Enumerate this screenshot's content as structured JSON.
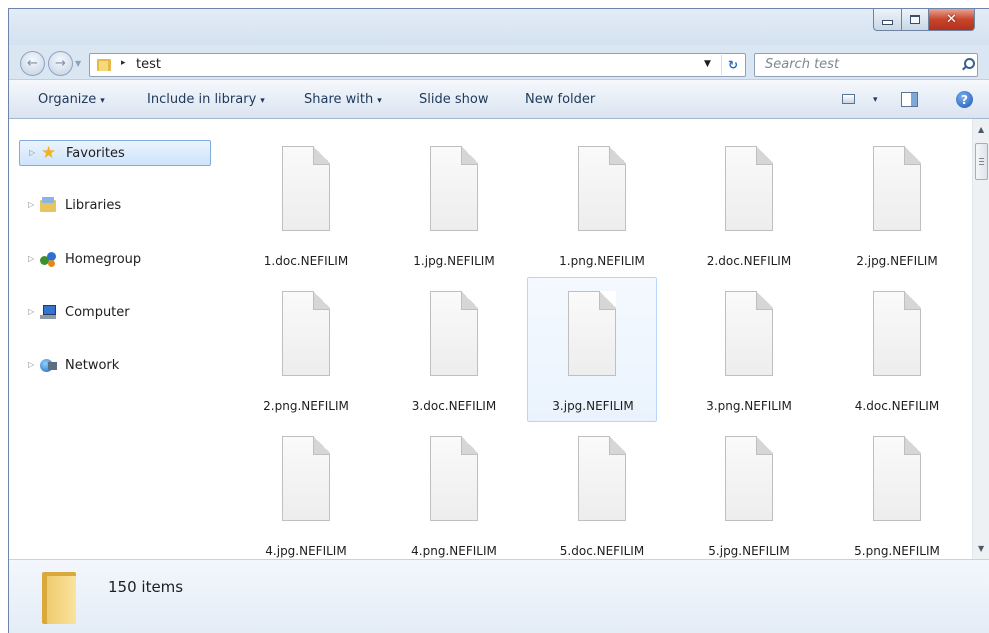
{
  "window": {
    "minimize_icon": "minimize-icon",
    "maximize_icon": "maximize-icon",
    "close_icon": "close-icon",
    "close_color": "#c8452c"
  },
  "nav": {
    "back_icon": "back-arrow-icon",
    "forward_icon": "forward-arrow-icon"
  },
  "address": {
    "separator": "▸",
    "path": "test",
    "dropdown": "▼",
    "refresh": "↻"
  },
  "search": {
    "placeholder": "Search test"
  },
  "toolbar": {
    "organize": "Organize",
    "include_in_library": "Include in library",
    "share_with": "Share with",
    "slide_show": "Slide show",
    "new_folder": "New folder",
    "caret": "▾",
    "help": "?"
  },
  "sidebar": {
    "items": [
      {
        "label": "Favorites",
        "icon": "star-icon"
      },
      {
        "label": "Libraries",
        "icon": "libraries-icon"
      },
      {
        "label": "Homegroup",
        "icon": "homegroup-icon"
      },
      {
        "label": "Computer",
        "icon": "computer-icon"
      },
      {
        "label": "Network",
        "icon": "network-icon"
      }
    ]
  },
  "files": [
    "1.doc.NEFILIM",
    "1.jpg.NEFILIM",
    "1.png.NEFILIM",
    "2.doc.NEFILIM",
    "2.jpg.NEFILIM",
    "2.png.NEFILIM",
    "3.doc.NEFILIM",
    "3.jpg.NEFILIM",
    "3.png.NEFILIM",
    "4.doc.NEFILIM",
    "4.jpg.NEFILIM",
    "4.png.NEFILIM",
    "5.doc.NEFILIM",
    "5.jpg.NEFILIM",
    "5.png.NEFILIM"
  ],
  "selected_file": "3.jpg.NEFILIM",
  "status": {
    "item_count": "150 items"
  },
  "colors": {
    "selection_bg": "#e8f2fd",
    "selection_border": "#b8d6fb",
    "accent": "#1e395b"
  }
}
